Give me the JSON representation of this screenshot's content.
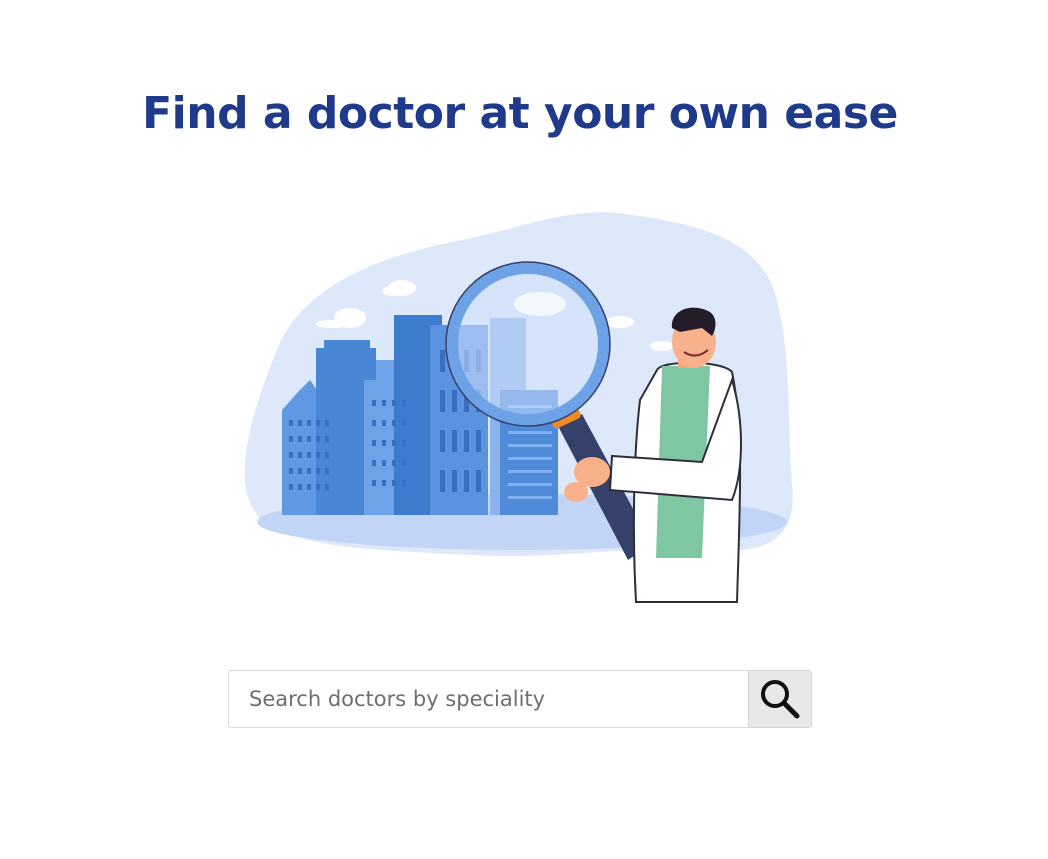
{
  "headline": "Find a doctor at your own ease",
  "hero": {
    "illustration": "doctor-with-magnifying-glass-city-illustration"
  },
  "search": {
    "placeholder": "Search doctors by speciality",
    "value": "",
    "button_icon": "search-icon"
  },
  "colors": {
    "headline": "#1f3a8a",
    "illustration_blob": "#dde7fb",
    "buildings": "#4a86d6",
    "button_background": "#e8e8e8"
  }
}
